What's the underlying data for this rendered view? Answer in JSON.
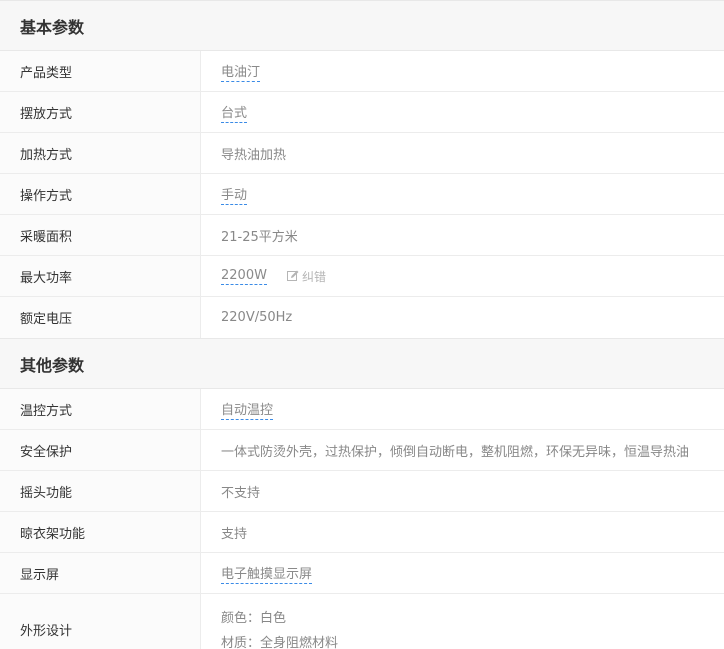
{
  "sections": [
    {
      "title": "基本参数",
      "rows": [
        {
          "label": "产品类型",
          "value": "电油汀"
        },
        {
          "label": "摆放方式",
          "value": "台式"
        },
        {
          "label": "加热方式",
          "value": "导热油加热"
        },
        {
          "label": "操作方式",
          "value": "手动"
        },
        {
          "label": "采暖面积",
          "value": "21-25平方米"
        },
        {
          "label": "最大功率",
          "value": "2200W",
          "action": "纠错"
        },
        {
          "label": "额定电压",
          "value": "220V/50Hz"
        }
      ]
    },
    {
      "title": "其他参数",
      "rows": [
        {
          "label": "温控方式",
          "value": "自动温控"
        },
        {
          "label": "安全保护",
          "value": "一体式防烫外壳，过热保护，倾倒自动断电，整机阻燃，环保无异味，恒温导热油"
        },
        {
          "label": "摇头功能",
          "value": "不支持"
        },
        {
          "label": "晾衣架功能",
          "value": "支持"
        },
        {
          "label": "显示屏",
          "value": "电子触摸显示屏"
        },
        {
          "label": "外形设计",
          "lines": [
            "颜色：白色",
            "材质：全身阻燃材料"
          ]
        }
      ]
    }
  ],
  "icons": {
    "correct": "edit-icon"
  },
  "colors": {
    "link_underline": "#3b8be6",
    "header_bg": "#f7f7f7"
  }
}
